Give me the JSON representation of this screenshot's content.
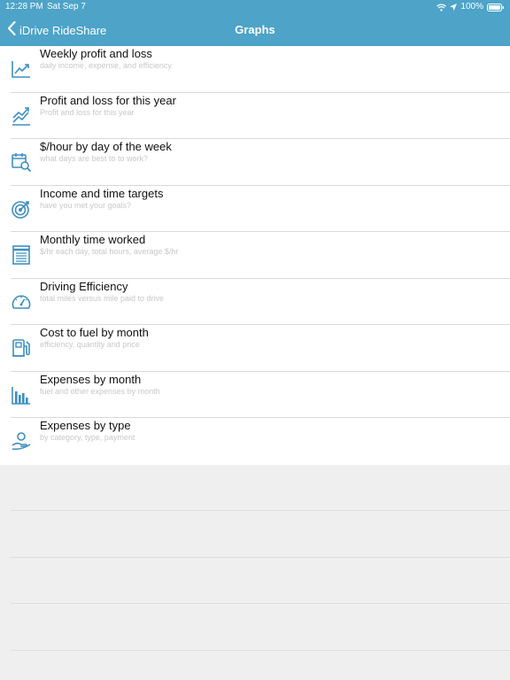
{
  "status_bar": {
    "time": "12:28 PM",
    "date": "Sat Sep 7",
    "battery": "100%",
    "wifi_icon": "wifi-icon",
    "location_icon": "location-arrow-icon",
    "battery_icon": "battery-icon"
  },
  "nav": {
    "back_label": "iDrive RideShare",
    "title": "Graphs"
  },
  "colors": {
    "header": "#4da3c8",
    "icon": "#3d8fc0",
    "subtitle": "#c8c8c8"
  },
  "items": [
    {
      "title": "Weekly profit and loss",
      "subtitle": "daily income, expense, and efficiency",
      "icon": "line-chart-up-icon"
    },
    {
      "title": "Profit and loss for this year",
      "subtitle": "Profit and loss for this year",
      "icon": "trend-chart-icon"
    },
    {
      "title": "$/hour by day of the week",
      "subtitle": "what days are best to to work?",
      "icon": "calendar-search-icon"
    },
    {
      "title": "Income and time targets",
      "subtitle": "have you met your goals?",
      "icon": "target-icon"
    },
    {
      "title": "Monthly time worked",
      "subtitle": "$/hr each day, total hours, average $/hr",
      "icon": "document-list-icon"
    },
    {
      "title": "Driving Efficiency",
      "subtitle": "total miles versus mile paid to drive",
      "icon": "speedometer-icon"
    },
    {
      "title": "Cost to fuel by month",
      "subtitle": "efficiency, quantity and price",
      "icon": "fuel-pump-icon"
    },
    {
      "title": "Expenses by month",
      "subtitle": "fuel and other expenses by month",
      "icon": "bar-chart-icon"
    },
    {
      "title": "Expenses by type",
      "subtitle": "by category, type, payment",
      "icon": "hand-coin-icon"
    }
  ]
}
